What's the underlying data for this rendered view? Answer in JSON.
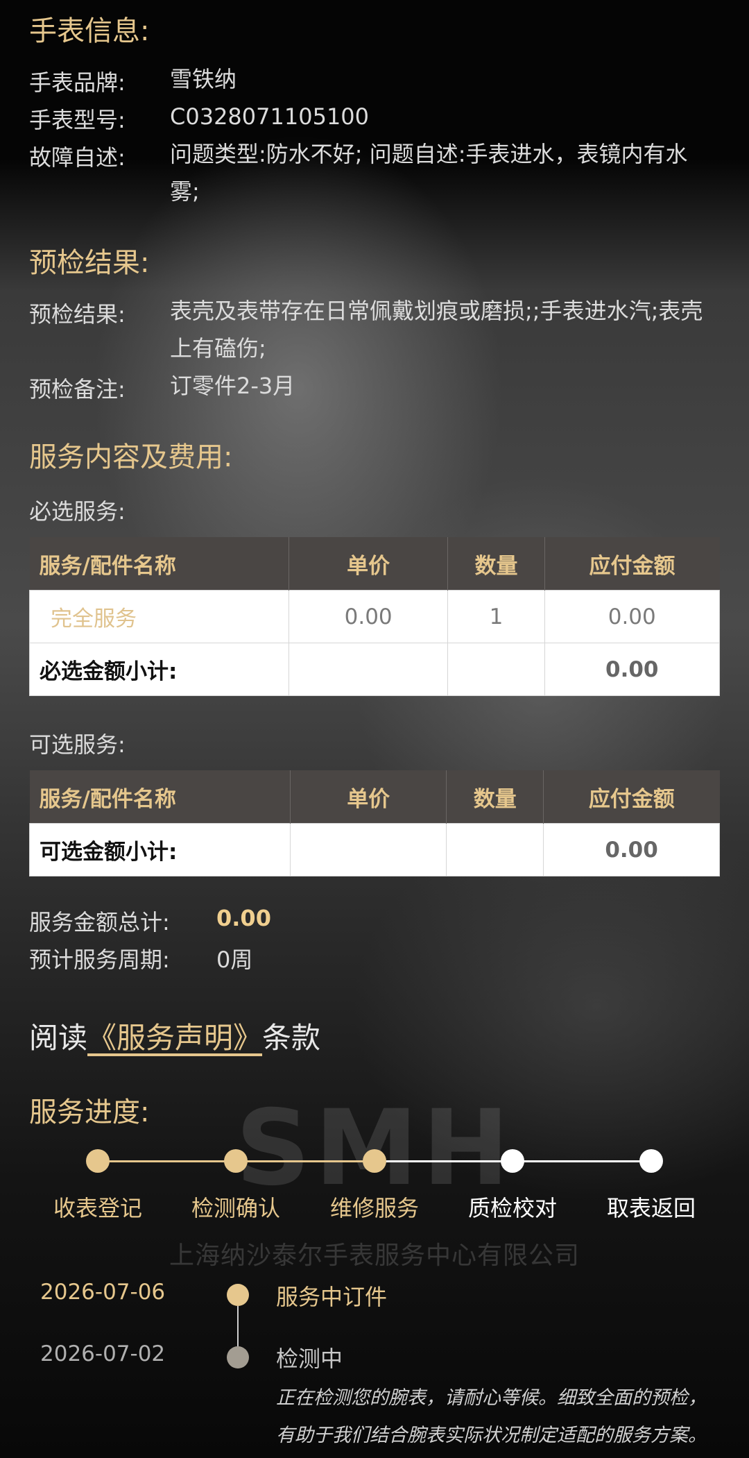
{
  "watch_info": {
    "title": "手表信息:",
    "brand_label": "手表品牌:",
    "brand_value": "雪铁纳",
    "model_label": "手表型号:",
    "model_value": "C0328071105100",
    "fault_label": "故障自述:",
    "fault_value": "问题类型:防水不好;  问题自述:手表进水，表镜内有水雾;"
  },
  "precheck": {
    "title": "预检结果:",
    "result_label": "预检结果:",
    "result_value": "表壳及表带存在日常佩戴划痕或磨损;;手表进水汽;表壳上有磕伤;",
    "note_label": "预检备注:",
    "note_value": "订零件2-3月"
  },
  "services": {
    "title": "服务内容及费用:",
    "required_label": "必选服务:",
    "optional_label": "可选服务:",
    "columns": [
      "服务/配件名称",
      "单价",
      "数量",
      "应付金额"
    ],
    "required_rows": [
      {
        "name": "完全服务",
        "price": "0.00",
        "qty": "1",
        "amount": "0.00"
      }
    ],
    "required_subtotal_label": "必选金额小计:",
    "required_subtotal_value": "0.00",
    "optional_subtotal_label": "可选金额小计:",
    "optional_subtotal_value": "0.00",
    "total_label": "服务金额总计:",
    "total_value": "0.00",
    "period_label": "预计服务周期:",
    "period_value": "0周"
  },
  "statement": {
    "prefix": "阅读",
    "link": "《服务声明》",
    "suffix": "条款"
  },
  "progress": {
    "title": "服务进度:",
    "steps": [
      {
        "label": "收表登记",
        "done": true
      },
      {
        "label": "检测确认",
        "done": true
      },
      {
        "label": "维修服务",
        "done": true
      },
      {
        "label": "质检校对",
        "done": false
      },
      {
        "label": "取表返回",
        "done": false
      }
    ],
    "watermark_big": "SMH",
    "watermark_small": "上海纳沙泰尔手表服务中心有限公司"
  },
  "timeline": [
    {
      "date": "2026-07-06",
      "status": "服务中订件",
      "desc": ""
    },
    {
      "date": "2026-07-02",
      "status": "检测中",
      "desc": "正在检测您的腕表，请耐心等候。细致全面的预检，有助于我们结合腕表实际状况制定适配的服务方案。"
    }
  ],
  "colors": {
    "gold": "#e6c78d",
    "grey_dot": "#a39d92",
    "white": "#ffffff"
  }
}
